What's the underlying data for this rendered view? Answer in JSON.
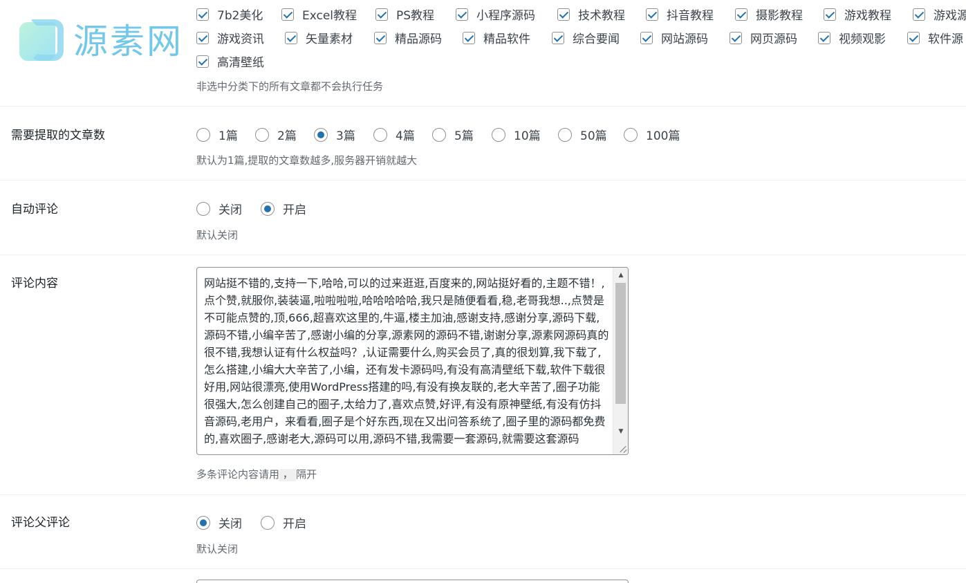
{
  "logo": {
    "text": "源素网"
  },
  "categories": {
    "items": [
      "7b2美化",
      "Excel教程",
      "PS教程",
      "小程序源码",
      "技术教程",
      "抖音教程",
      "摄影教程",
      "游戏教程",
      "游戏源",
      "游戏资讯",
      "矢量素材",
      "精品源码",
      "精品软件",
      "综合要闻",
      "网站源码",
      "网页源码",
      "视频观影",
      "软件源",
      "高清壁纸"
    ],
    "hint": "非选中分类下的所有文章都不会执行任务"
  },
  "article_count": {
    "label": "需要提取的文章数",
    "options": [
      "1篇",
      "2篇",
      "3篇",
      "4篇",
      "5篇",
      "10篇",
      "50篇",
      "100篇"
    ],
    "selected": "3篇",
    "hint": "默认为1篇,提取的文章数越多,服务器开销就越大"
  },
  "auto_comment": {
    "label": "自动评论",
    "options": [
      "关闭",
      "开启"
    ],
    "selected": "开启",
    "hint": "默认关闭"
  },
  "comment_content": {
    "label": "评论内容",
    "value": "网站挺不错的,支持一下,哈哈,可以的过来逛逛,百度来的,网站挺好看的,主题不错！,点个赞,就服你,装装逼,啦啦啦啦,哈哈哈哈哈,我只是随便看看,稳,老哥我想..,点赞是不可能点赞的,顶,666,超喜欢这里的,牛逼,楼主加油,感谢支持,感谢分享,源码下载,源码不错,小编辛苦了,感谢小编的分享,源素网的源码不错,谢谢分享,源素网源码真的很不错,我想认证有什么权益吗？,认证需要什么,购买会员了,真的很划算,我下载了,怎么搭建,小编大大辛苦了,小编，还有发卡源码吗,有没有高清壁纸下载,软件下载很好用,网站很漂亮,使用WordPress搭建的吗,有没有换友联的,老大辛苦了,圈子功能很强大,怎么创建自己的圈子,太给力了,喜欢点赞,好评,有没有原神壁纸,有没有仿抖音源码,老用户，来看看,圈子是个好东西,现在又出问答系统了,圈子里的源码都免费的,喜欢圈子,感谢老大,源码可以用,源码不错,我需要一套源码,就需要这套源码",
    "hint_prefix": "多条评论内容请用",
    "hint_code": "，",
    "hint_suffix": "隔开"
  },
  "parent_comment": {
    "label": "评论父评论",
    "options": [
      "关闭",
      "开启"
    ],
    "selected": "关闭",
    "hint": "默认关闭"
  }
}
